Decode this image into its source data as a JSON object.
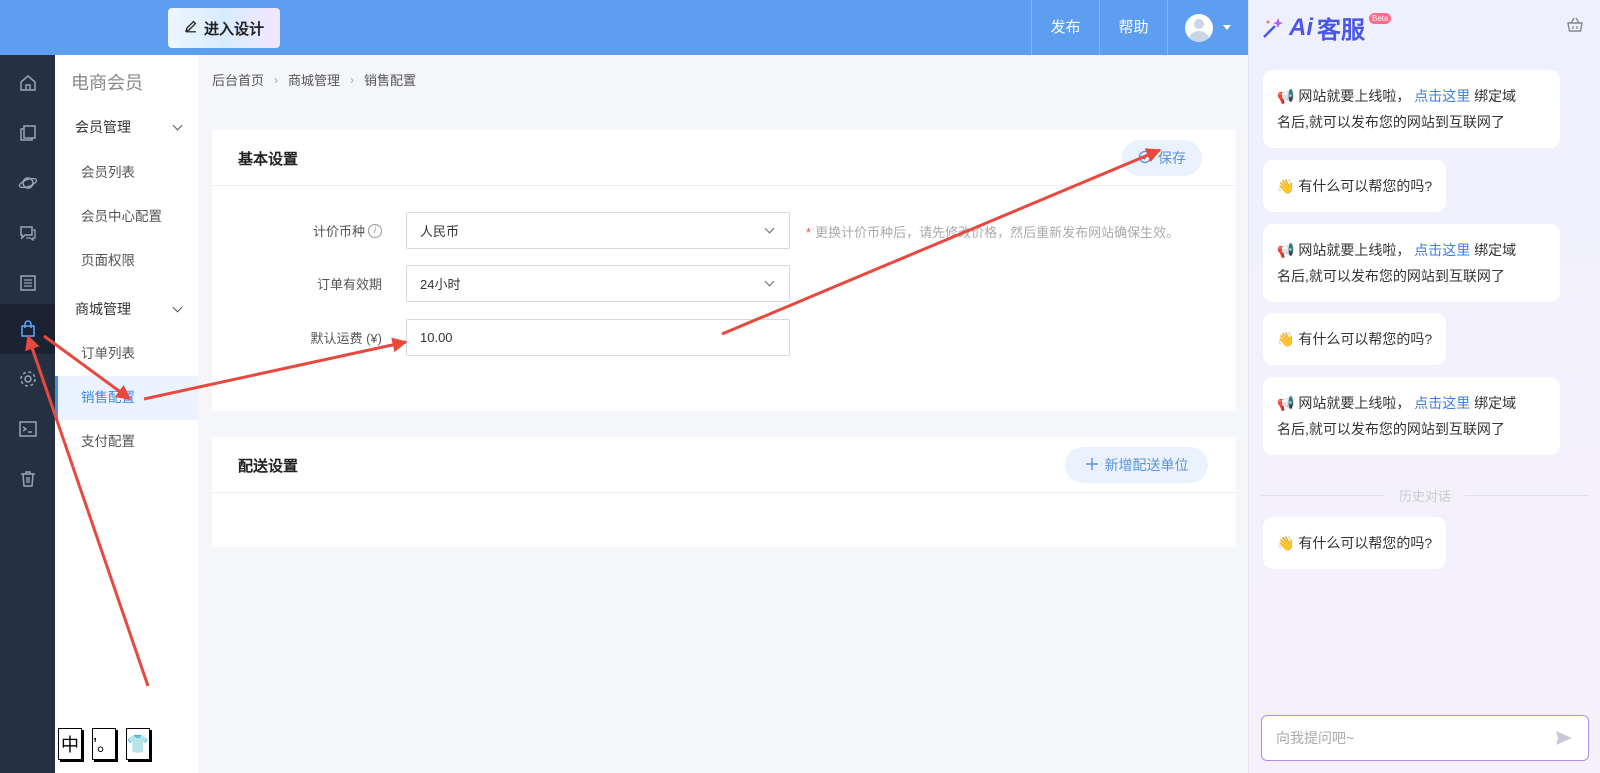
{
  "topbar": {
    "design_button": "进入设计",
    "publish": "发布",
    "help": "帮助"
  },
  "rail": {
    "icons": [
      "home-icon",
      "copy-icon",
      "planet-icon",
      "chat-icon",
      "list-icon",
      "shopping-bag-icon",
      "gear-icon",
      "terminal-icon",
      "trash-icon"
    ],
    "active_index": 5
  },
  "subnav": {
    "title": "电商会员",
    "groups": [
      {
        "label": "会员管理",
        "items": [
          "会员列表",
          "会员中心配置",
          "页面权限"
        ]
      },
      {
        "label": "商城管理",
        "items": [
          "订单列表",
          "销售配置",
          "支付配置"
        ]
      }
    ],
    "active_item": "销售配置"
  },
  "breadcrumb": [
    "后台首页",
    "商城管理",
    "销售配置"
  ],
  "basic_settings": {
    "title": "基本设置",
    "save_label": "保存",
    "currency": {
      "label": "计价币种",
      "value": "人民币",
      "hint": "更换计价币种后，请先修改价格，然后重新发布网站确保生效。"
    },
    "validity": {
      "label": "订单有效期",
      "value": "24小时"
    },
    "shipping": {
      "label": "默认运费 (¥)",
      "value": "10.00"
    }
  },
  "delivery_settings": {
    "title": "配送设置",
    "add_label": "新增配送单位"
  },
  "chat": {
    "logo_ai": "Ai",
    "logo_name": "客服",
    "beta": "Beta",
    "notice_prefix": "网站就要上线啦，",
    "notice_link": "点击这里",
    "notice_suffix_1": " 绑定域",
    "notice_suffix_2": "名后,就可以发布您的网站到互联网了",
    "greeting": "有什么可以帮您的吗?",
    "history_divider": "历史对话",
    "input_placeholder": "向我提问吧~"
  },
  "ime": [
    "中",
    "’。",
    "👕"
  ],
  "colors": {
    "topbar": "#5d9ef0",
    "rail": "#253042",
    "accent": "#4a90e2",
    "annotation_arrow": "#e8493f"
  }
}
